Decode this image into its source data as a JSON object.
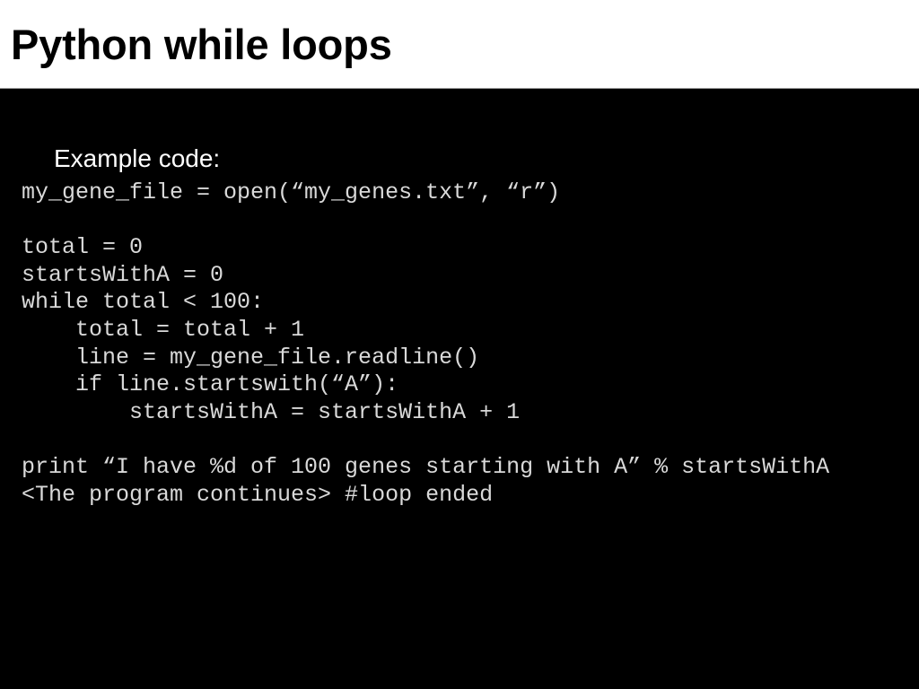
{
  "slide": {
    "title": "Python while loops",
    "section_label": "Example code:",
    "colors": {
      "header_background": "#ffffff",
      "header_text": "#000000",
      "header_rule": "#9a9a9a",
      "body_background": "#000000",
      "label_text": "#ffffff",
      "code_text": "#d9d9d9"
    },
    "code_lines": [
      "my_gene_file = open(“my_genes.txt”, “r”)",
      "",
      "total = 0",
      "startsWithA = 0",
      "while total < 100:",
      "    total = total + 1",
      "    line = my_gene_file.readline()",
      "    if line.startswith(“A”):",
      "        startsWithA = startsWithA + 1",
      "",
      "print “I have %d of 100 genes starting with A” % startsWithA",
      "<The program continues> #loop ended"
    ]
  }
}
